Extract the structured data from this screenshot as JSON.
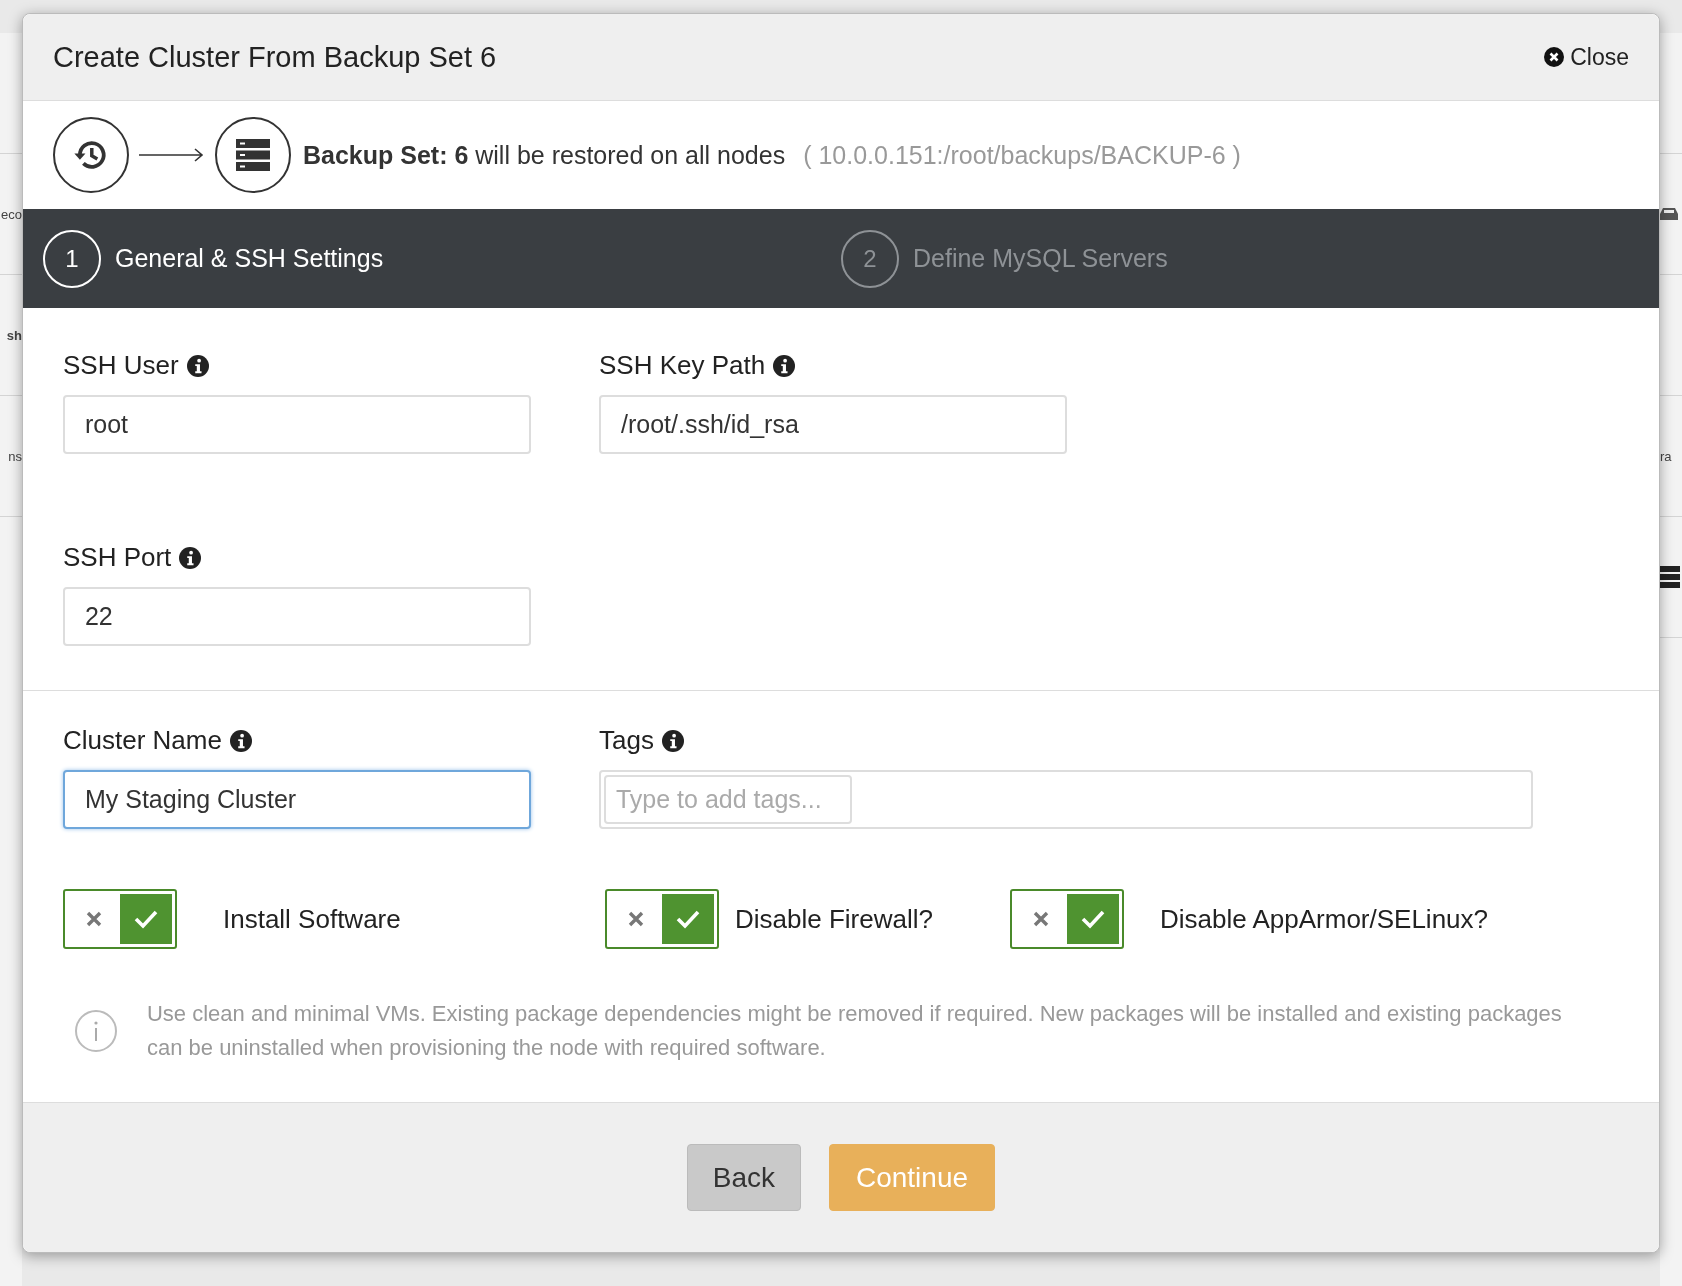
{
  "background": {
    "left_fragments": [
      "eco",
      "sh",
      "ns"
    ],
    "right_fragments": [
      "ra"
    ]
  },
  "dialog": {
    "title": "Create Cluster From Backup Set 6",
    "close_label": "Close"
  },
  "restore_info": {
    "text": "**Backup Set: 6** will be restored on all nodes",
    "path": "( 10.0.0.151:/root/backups/BACKUP-6 )"
  },
  "steps": [
    {
      "number": "1",
      "label": "General & SSH Settings",
      "selected": true
    },
    {
      "number": "2",
      "label": "Define MySQL Servers",
      "selected": false
    }
  ],
  "ssh_fields": [
    {
      "label": "SSH User",
      "value": "root",
      "focused": false
    },
    {
      "label": "SSH Key Path",
      "value": "/root/.ssh/id_rsa",
      "focused": false
    },
    {
      "label": "SSH Port",
      "value": "22",
      "focused": false
    }
  ],
  "cluster_fields": [
    {
      "label": "Cluster Name",
      "value": "My Staging Cluster",
      "focused": true
    },
    {
      "label": "Tags",
      "placeholder": "Type to add tags..."
    }
  ],
  "toggles": [
    {
      "label": "Install Software",
      "on": true
    },
    {
      "label": "Disable Firewall?",
      "on": true
    },
    {
      "label": "Disable AppArmor/SELinux?",
      "on": true
    }
  ],
  "note": "Use clean and minimal VMs. Existing package dependencies might be removed if required. New packages will be installed and existing packages can be uninstalled when provisioning the node with required software.",
  "buttons": [
    {
      "label": "Back",
      "kind": "secondary"
    },
    {
      "label": "Continue",
      "kind": "primary"
    }
  ]
}
